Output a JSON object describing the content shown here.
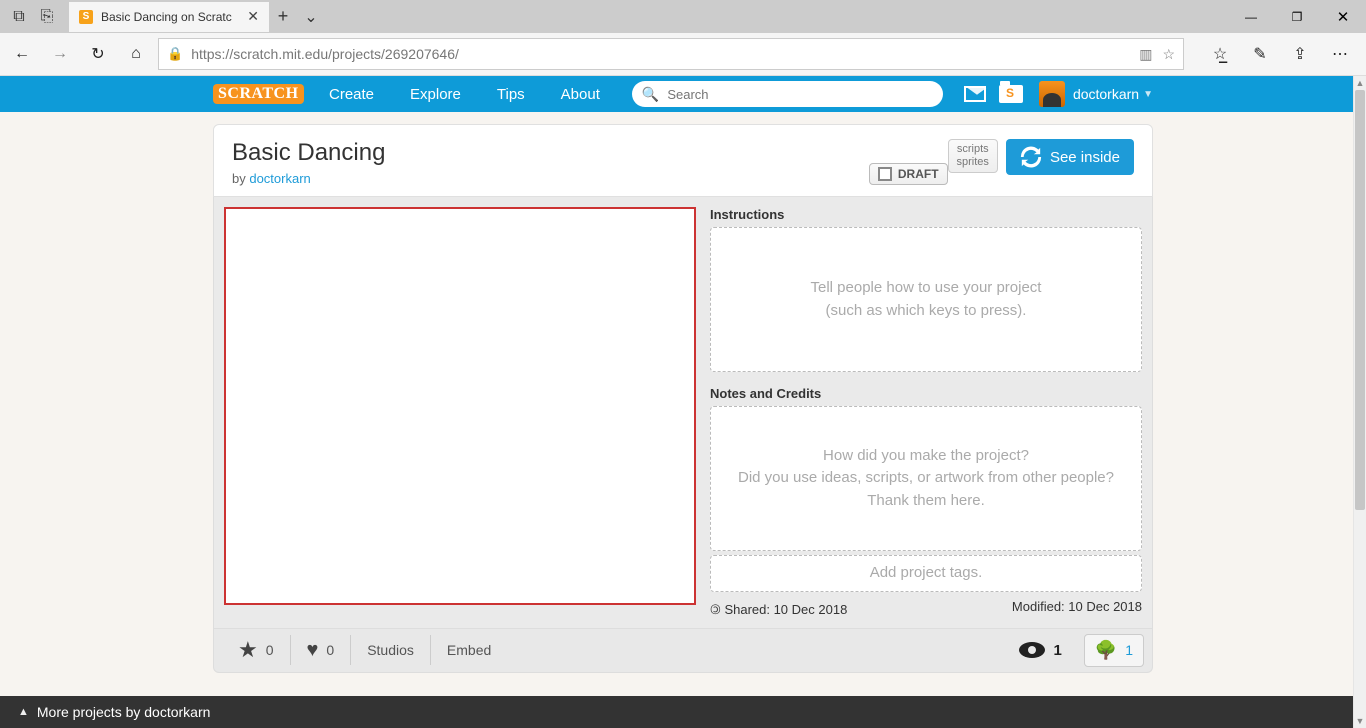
{
  "browser": {
    "tab_title": "Basic Dancing on Scratc",
    "url": "https://scratch.mit.edu/projects/269207646/"
  },
  "nav": {
    "create": "Create",
    "explore": "Explore",
    "tips": "Tips",
    "about": "About",
    "search_placeholder": "Search",
    "username": "doctorkarn"
  },
  "header": {
    "title": "Basic Dancing",
    "by": "by ",
    "author": "doctorkarn",
    "draft": "DRAFT",
    "scripts": "scripts",
    "sprites": "sprites",
    "see_inside": "See inside"
  },
  "meta": {
    "instructions_label": "Instructions",
    "instructions_ph1": "Tell people how to use your project",
    "instructions_ph2": "(such as which keys to press).",
    "notes_label": "Notes and Credits",
    "notes_ph1": "How did you make the project?",
    "notes_ph2": "Did you use ideas, scripts, or artwork from other people? Thank them here.",
    "tags_ph": "Add project tags.",
    "shared": "Shared: 10 Dec 2018",
    "modified": "Modified: 10 Dec 2018"
  },
  "stats": {
    "favs": "0",
    "loves": "0",
    "studios": "Studios",
    "embed": "Embed",
    "views": "1",
    "remix": "1"
  },
  "footer": {
    "more": "More projects by doctorkarn"
  }
}
